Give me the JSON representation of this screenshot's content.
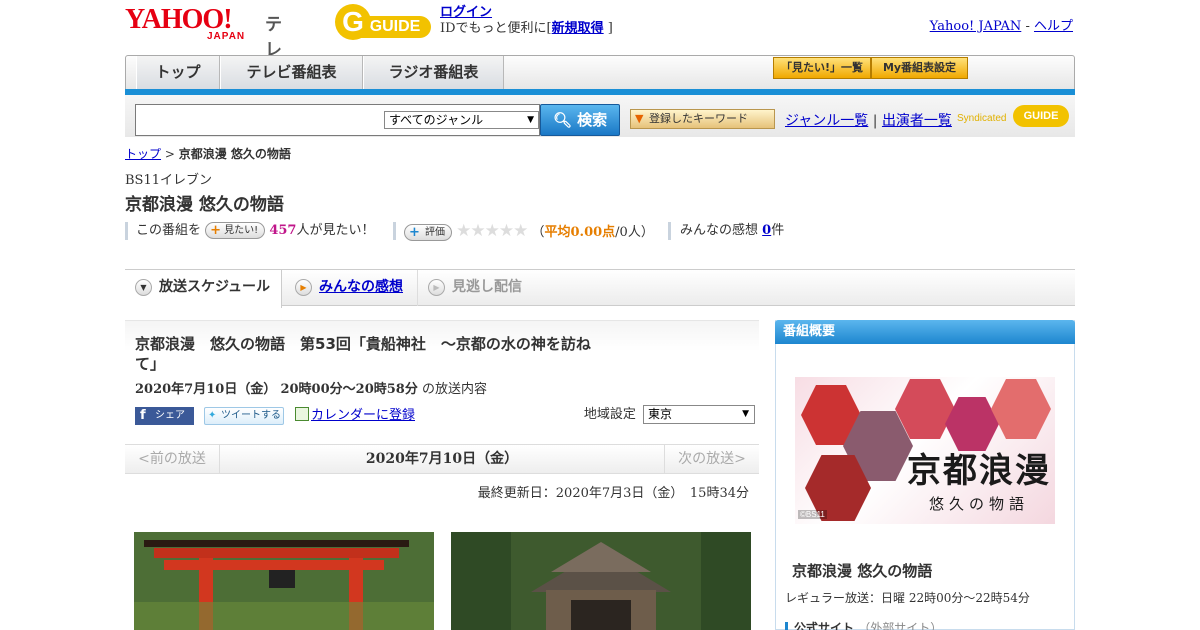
{
  "header": {
    "logo_yahoo": "YAHOO!",
    "logo_japan": "JAPAN",
    "logo_tv": "テレビ",
    "gguide_g": "G",
    "gguide_text": "GUIDE",
    "login_label": "ログイン",
    "login_sub_prefix": "IDでもっと便利に[",
    "register_label": "新規取得",
    "login_sub_suffix": "]",
    "yahoo_japan_link": "Yahoo! JAPAN",
    "help_separator": "-",
    "help_link": "ヘルプ"
  },
  "nav": {
    "tabs": [
      "トップ",
      "テレビ番組表",
      "ラジオ番組表"
    ],
    "mitai_list": "「見たい!」一覧",
    "my_schedule": "My番組表設定"
  },
  "search": {
    "genre_selected": "すべてのジャンル",
    "search_button": "検索",
    "keyword_button": "登録したキーワード",
    "genre_list": "ジャンル一覧",
    "divider": "|",
    "cast_list": "出演者一覧",
    "syndicated": "Syndicated",
    "syn_logo": "GUIDE"
  },
  "breadcrumb": {
    "top": "トップ",
    "sep": ">",
    "current": "京都浪漫 悠久の物語"
  },
  "program": {
    "channel": "BS11イレブン",
    "title": "京都浪漫 悠久の物語",
    "this_program": "この番組を",
    "mitai_btn": "見たい!",
    "mitai_count": "457",
    "mitai_suffix": "人が見たい！",
    "rating_btn": "評価",
    "stars": "★★★★★",
    "rating_open": "（",
    "rating_score": "平均0.00点",
    "rating_people": "/0人）",
    "review_label": "みんなの感想",
    "review_count": "0",
    "review_suffix": "件"
  },
  "tabs": {
    "schedule": "放送スケジュール",
    "reviews": "みんなの感想",
    "missed": "見逃し配信"
  },
  "episode": {
    "title": "京都浪漫　悠久の物語　第53回「貴船神社　～京都の水の神を訪ねて」",
    "date": "2020年7月10日（金）",
    "time": "20時00分～20時58分",
    "date_suffix": "の放送内容",
    "fb_share": "シェア",
    "tweet": "ツイートする",
    "calendar": "カレンダーに登録",
    "region_label": "地域設定",
    "region_value": "東京",
    "prev": "<前の放送",
    "current_date": "2020年7月10日（金）",
    "next": "次の放送>",
    "updated": "最終更新日：2020年7月3日（金）　15時34分"
  },
  "sidebar": {
    "heading": "番組概要",
    "poster_title": "京都浪漫",
    "poster_subtitle": "悠久の物語",
    "poster_copyright": "©BS11",
    "program_title": "京都浪漫 悠久の物語",
    "regular": "レギュラー放送：日曜 22時00分～22時54分",
    "official_site": "公式サイト",
    "official_site_note": "（外部サイト）"
  },
  "colors": {
    "accent_blue": "#1a8fd6",
    "brand_red": "#e60012",
    "gguide_yellow": "#f2c200",
    "orange": "#e67e00"
  }
}
